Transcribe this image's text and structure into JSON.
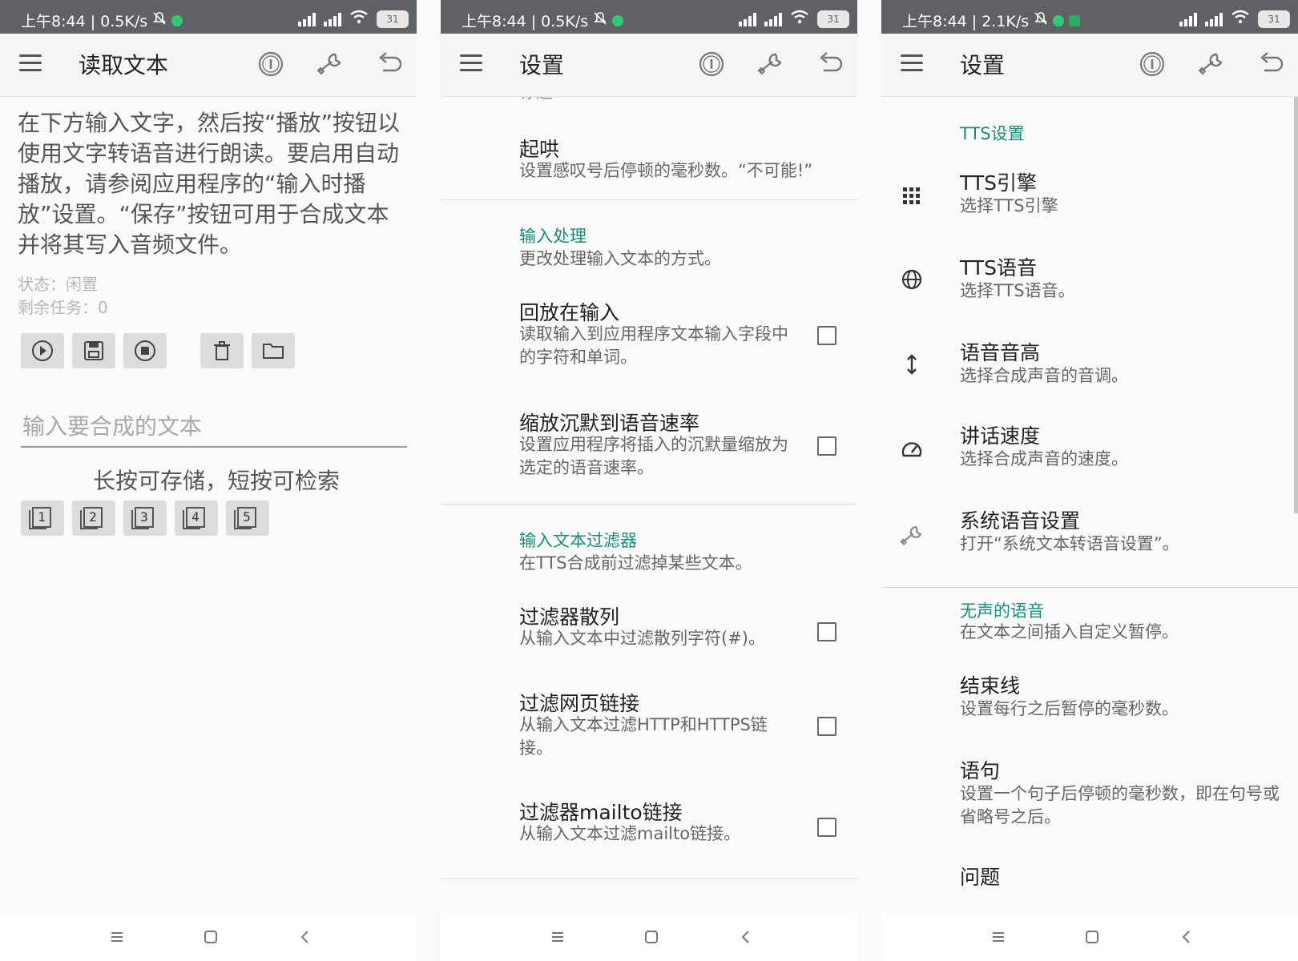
{
  "panels": [
    {
      "status_bar": {
        "time": "上午8:44 | 0.5K/s",
        "battery": "31"
      },
      "app_bar": {
        "title": "读取文本"
      },
      "intro": "在下方输入文字，然后按“播放”按钮以使用文字转语音进行朗读。要启用自动播放，请参阅应用程序的“输入时播放”设置。“保存”按钮可用于合成文本并将其写入音频文件。",
      "status": "状态：闲置",
      "remaining": "剩余任务：0",
      "input": {
        "placeholder": "输入要合成的文本",
        "value": ""
      },
      "hint": "长按可存储，短按可检索",
      "slots": [
        "1",
        "2",
        "3",
        "4",
        "5"
      ]
    },
    {
      "status_bar": {
        "time": "上午8:44 | 0.5K/s",
        "battery": "31"
      },
      "app_bar": {
        "title": "设置"
      },
      "cut_text": "标题",
      "items": [
        {
          "title": "起哄",
          "summary": "设置感叹号后停顿的毫秒数。“不可能!”"
        },
        {
          "category": "输入处理",
          "summary": "更改处理输入文本的方式。"
        },
        {
          "title": "回放在输入",
          "summary": "读取输入到应用程序文本输入字段中的字符和单词。"
        },
        {
          "title": "缩放沉默到语音速率",
          "summary": "设置应用程序将插入的沉默量缩放为选定的语音速率。"
        },
        {
          "category": "输入文本过滤器",
          "summary": "在TTS合成前过滤掉某些文本。"
        },
        {
          "title": "过滤器散列",
          "summary": "从输入文本中过滤散列字符(#)。"
        },
        {
          "title": "过滤网页链接",
          "summary": "从输入文本过滤HTTP和HTTPS链接。"
        },
        {
          "title": "过滤器mailto链接",
          "summary": "从输入文本过滤mailto链接。"
        }
      ]
    },
    {
      "status_bar": {
        "time": "上午8:44 | 2.1K/s",
        "battery": "31"
      },
      "app_bar": {
        "title": "设置"
      },
      "category_tts": "TTS设置",
      "items": [
        {
          "title": "TTS引擎",
          "summary": "选择TTS引擎",
          "icon": "grid-icon"
        },
        {
          "title": "TTS语音",
          "summary": "选择TTS语音。",
          "icon": "globe-icon"
        },
        {
          "title": "语音音高",
          "summary": "选择合成声音的音调。",
          "icon": "vertical-arrows-icon"
        },
        {
          "title": "讲话速度",
          "summary": "选择合成声音的速度。",
          "icon": "speedometer-icon"
        },
        {
          "title": "系统语音设置",
          "summary": "打开“系统文本转语音设置”。",
          "icon": "wrench-icon"
        }
      ],
      "category_silence": "无声的语音",
      "category_silence_summary": "在文本之间插入自定义暂停。",
      "items2": [
        {
          "title": "结束线",
          "summary": "设置每行之后暂停的毫秒数。"
        },
        {
          "title": "语句",
          "summary": "设置一个句子后停顿的毫秒数，即在句号或省略号之后。"
        },
        {
          "title": "问题",
          "summary": ""
        }
      ]
    }
  ],
  "colors": {
    "accent": "#1b8a7a",
    "status_bar": "#5f6164",
    "app_bar": "#f5f5f5",
    "background": "#fafafa"
  }
}
